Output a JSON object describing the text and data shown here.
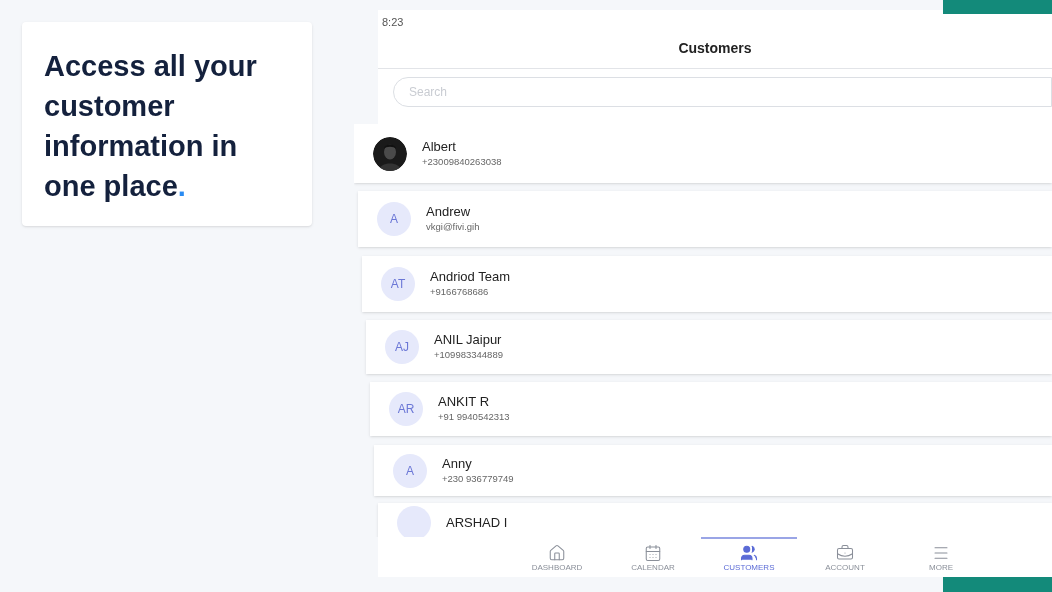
{
  "promo": {
    "headline": "Access all your customer information in one place",
    "accent": "."
  },
  "status_bar": {
    "time": "8:23"
  },
  "header": {
    "title": "Customers"
  },
  "search": {
    "placeholder": "Search"
  },
  "customers": [
    {
      "name": "Albert",
      "detail": "+23009840263038"
    },
    {
      "name": "Andrew",
      "detail": "vkgi@fivi.gih",
      "kind": "initials",
      "initials": "A"
    },
    {
      "name": "Andriod Team",
      "detail": "+9166768686",
      "kind": "initials",
      "initials": "AT"
    },
    {
      "name": "ANIL Jaipur",
      "detail": "+109983344889",
      "kind": "initials",
      "initials": "AJ"
    },
    {
      "name": "ANKIT R",
      "detail": "+91 9940542313",
      "kind": "initials",
      "initials": "AR"
    },
    {
      "name": "Anny",
      "detail": "+230 936779749",
      "kind": "initials",
      "initials": "A"
    },
    {
      "name": "ARSHAD I",
      "kind": "initials"
    }
  ],
  "tabs": [
    {
      "label": "DASHBOARD",
      "selected": false
    },
    {
      "label": "CALENDAR",
      "selected": false
    },
    {
      "label": "CUSTOMERS",
      "selected": true
    },
    {
      "label": "ACCOUNT",
      "selected": false
    },
    {
      "label": "MORE",
      "selected": false
    }
  ]
}
